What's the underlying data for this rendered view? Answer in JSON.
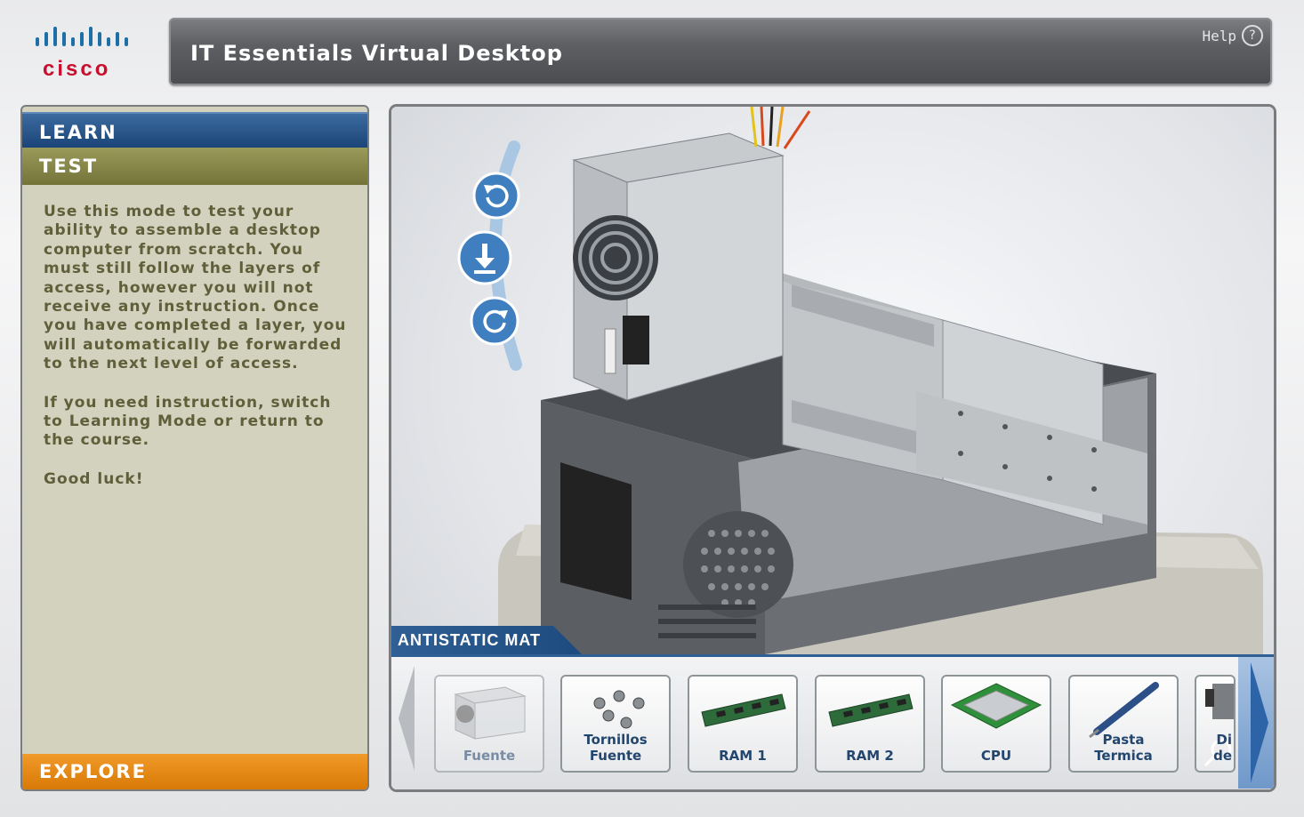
{
  "brand": {
    "name": "cisco"
  },
  "header": {
    "title": "IT Essentials Virtual Desktop",
    "help_label": "Help",
    "help_icon": "?"
  },
  "sidebar": {
    "tabs": [
      {
        "label": "LEARN",
        "color": "#1b4479"
      },
      {
        "label": "TEST",
        "color": "#74743a"
      },
      {
        "label": "EXPLORE",
        "color": "#d87905"
      }
    ],
    "description": [
      "Use this mode to test your ability to assemble a desktop computer from scratch. You must still follow the layers of access, however you will not receive any instruction. Once you have completed a layer, you will automatically be forwarded to the next level of access.",
      "If you need instruction, switch to Learning Mode or return to the course.",
      "Good luck!"
    ]
  },
  "workspace": {
    "surface_label": "ANTISTATIC MAT",
    "controls": [
      "rotate-left-icon",
      "place-down-icon",
      "rotate-right-icon"
    ],
    "tray_items": [
      {
        "label_1": "Fuente",
        "label_2": "",
        "icon": "power-supply-icon",
        "state": "used"
      },
      {
        "label_1": "Tornillos",
        "label_2": "Fuente",
        "icon": "screws-icon",
        "state": "available"
      },
      {
        "label_1": "RAM 1",
        "label_2": "",
        "icon": "ram-icon",
        "state": "available"
      },
      {
        "label_1": "RAM 2",
        "label_2": "",
        "icon": "ram-icon",
        "state": "available"
      },
      {
        "label_1": "CPU",
        "label_2": "",
        "icon": "cpu-icon",
        "state": "available"
      },
      {
        "label_1": "Pasta",
        "label_2": "Termica",
        "icon": "thermal-paste-icon",
        "state": "available"
      },
      {
        "label_1": "Di",
        "label_2": "de",
        "icon": "heatsink-icon",
        "state": "partial"
      }
    ]
  }
}
